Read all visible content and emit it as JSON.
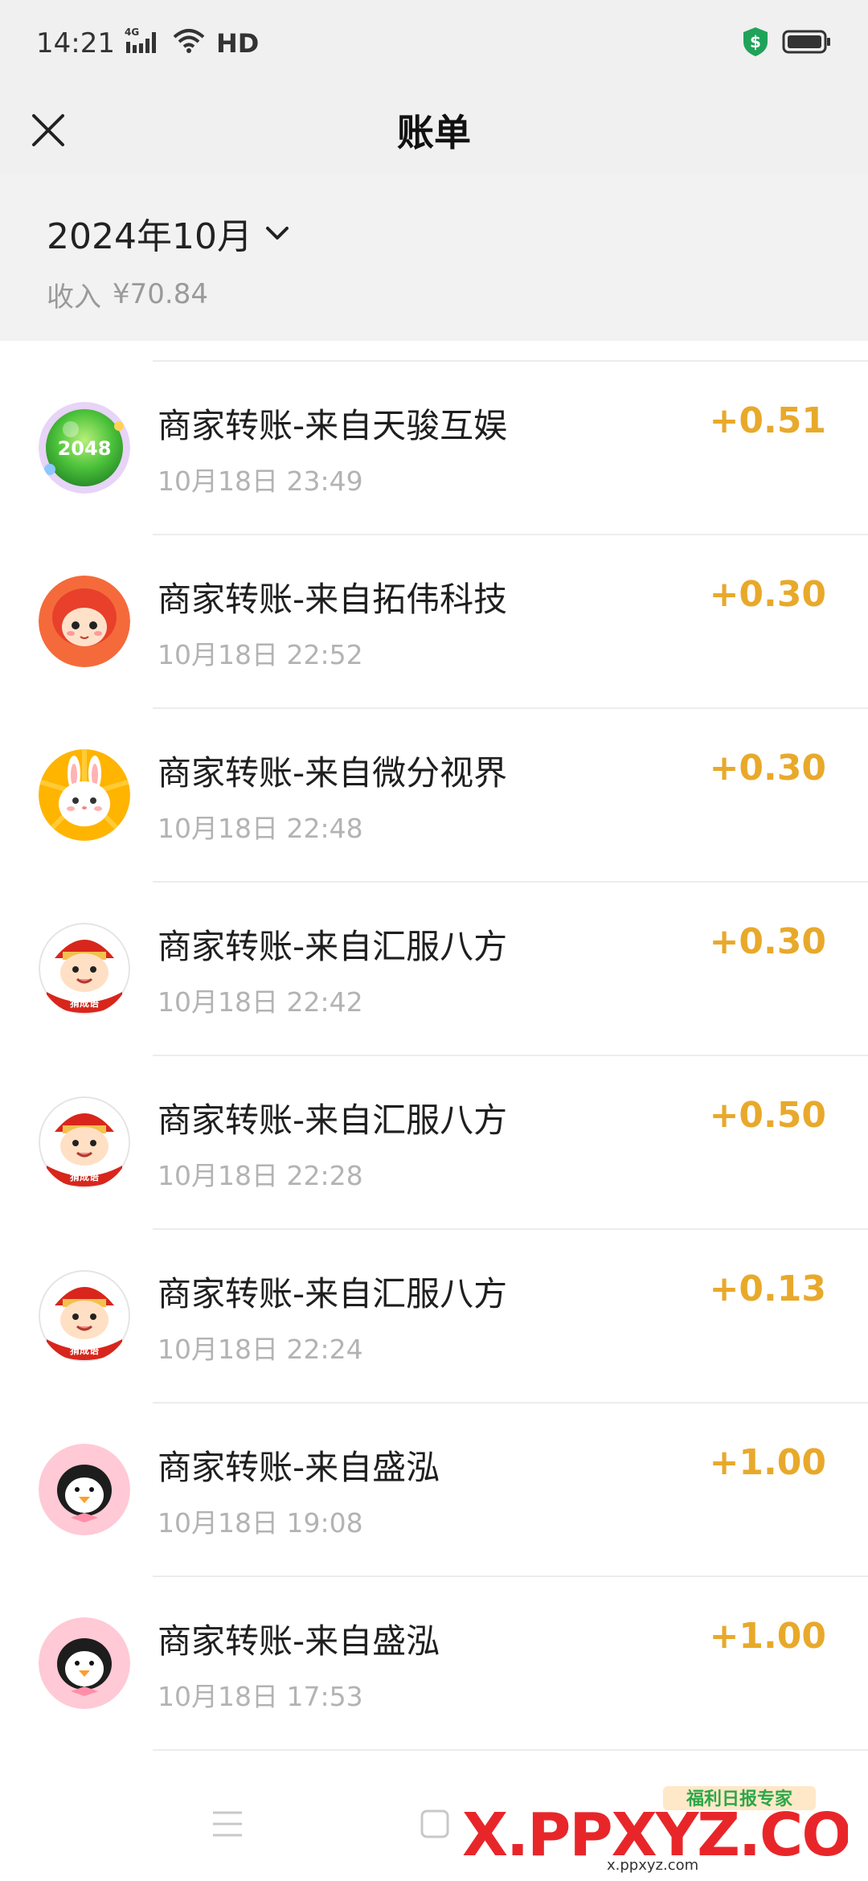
{
  "status_bar": {
    "time": "14:21",
    "network": "4G",
    "hd_label": "HD",
    "shield_symbol": "$"
  },
  "nav": {
    "title": "账单"
  },
  "summary": {
    "month": "2024年10月",
    "income_label": "收入",
    "income_value": "¥70.84"
  },
  "transactions": [
    {
      "title": "商家转账-来自天骏互娱",
      "time": "10月18日 23:49",
      "amount": "+0.51",
      "avatar": "game-2048-avatar",
      "avatar_text": "2048"
    },
    {
      "title": "商家转账-来自拓伟科技",
      "time": "10月18日 22:52",
      "amount": "+0.30",
      "avatar": "red-doll-avatar"
    },
    {
      "title": "商家转账-来自微分视界",
      "time": "10月18日 22:48",
      "amount": "+0.30",
      "avatar": "bunny-avatar"
    },
    {
      "title": "商家转账-来自汇服八方",
      "time": "10月18日 22:42",
      "amount": "+0.30",
      "avatar": "boy-avatar",
      "avatar_text": "猜成语"
    },
    {
      "title": "商家转账-来自汇服八方",
      "time": "10月18日 22:28",
      "amount": "+0.50",
      "avatar": "boy-avatar",
      "avatar_text": "猜成语"
    },
    {
      "title": "商家转账-来自汇服八方",
      "time": "10月18日 22:24",
      "amount": "+0.13",
      "avatar": "boy-avatar",
      "avatar_text": "猜成语"
    },
    {
      "title": "商家转账-来自盛泓",
      "time": "10月18日 19:08",
      "amount": "+1.00",
      "avatar": "penguin-avatar"
    },
    {
      "title": "商家转账-来自盛泓",
      "time": "10月18日 17:53",
      "amount": "+1.00",
      "avatar": "penguin-avatar"
    }
  ],
  "watermark": {
    "brand": "福利日报专家",
    "site": "X.PPXYZ.COM",
    "url": "x.ppxyz.com"
  },
  "colors": {
    "amount": "#e8a92b",
    "header_bg": "#f0f0f0",
    "time_text": "#b3b3b3"
  }
}
